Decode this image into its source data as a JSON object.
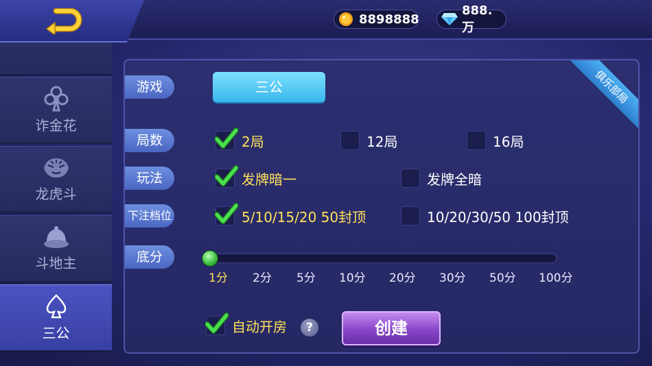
{
  "currency": {
    "gold": "8898888",
    "diamond": "888.万"
  },
  "sidebar": {
    "items": [
      {
        "label": "诈金花",
        "icon": "club-icon"
      },
      {
        "label": "龙虎斗",
        "icon": "tiger-icon"
      },
      {
        "label": "斗地主",
        "icon": "hat-icon"
      },
      {
        "label": "三公",
        "icon": "spade-icon",
        "active": true
      }
    ]
  },
  "panel": {
    "ribbon": "俱乐部局",
    "rows": {
      "game": {
        "label": "游戏",
        "value": "三公"
      },
      "rounds": {
        "label": "局数",
        "options": [
          {
            "label": "2局",
            "checked": true
          },
          {
            "label": "12局",
            "checked": false
          },
          {
            "label": "16局",
            "checked": false
          }
        ]
      },
      "play": {
        "label": "玩法",
        "options": [
          {
            "label": "发牌暗一",
            "checked": true
          },
          {
            "label": "发牌全暗",
            "checked": false
          }
        ]
      },
      "bet": {
        "label": "下注档位",
        "options": [
          {
            "label": "5/10/15/20 50封顶",
            "checked": true
          },
          {
            "label": "10/20/30/50 100封顶",
            "checked": false
          }
        ]
      },
      "base": {
        "label": "底分",
        "ticks": [
          "1分",
          "2分",
          "5分",
          "10分",
          "20分",
          "30分",
          "50分",
          "100分"
        ],
        "selected": "1分"
      }
    },
    "auto_open": {
      "label": "自动开房",
      "checked": true
    },
    "help": "?",
    "create": "创建"
  },
  "colors": {
    "accent": "#3ab7ec",
    "selected_text": "#ffe15c",
    "check": "#3ccf3f"
  }
}
